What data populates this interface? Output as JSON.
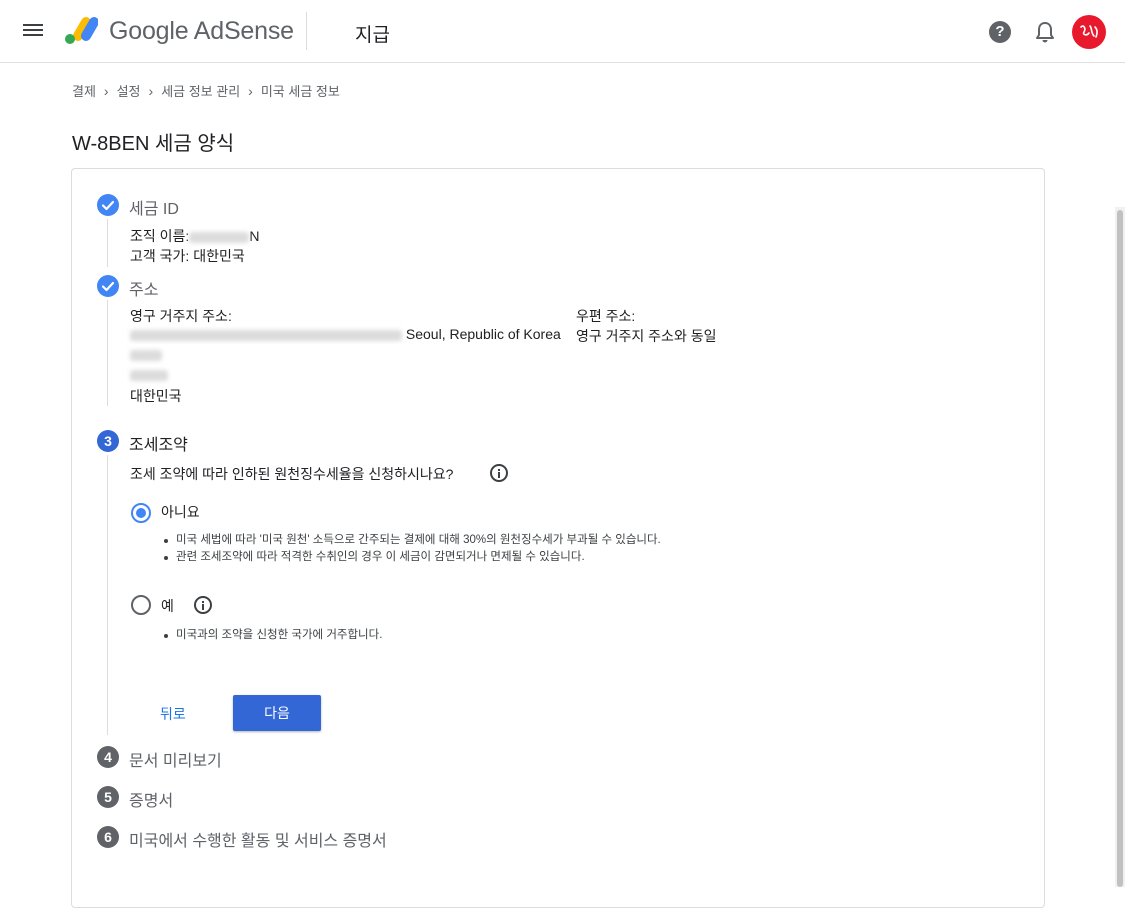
{
  "app": {
    "product_name": "Google AdSense",
    "page_heading": "지급"
  },
  "breadcrumb": [
    "결제",
    "설정",
    "세금 정보 관리",
    "미국 세금 정보"
  ],
  "form": {
    "title": "W-8BEN 세금 양식"
  },
  "steps": [
    {
      "number": "1",
      "title": "세금 ID",
      "state": "done"
    },
    {
      "number": "2",
      "title": "주소",
      "state": "done"
    },
    {
      "number": "3",
      "title": "조세조약",
      "state": "active"
    },
    {
      "number": "4",
      "title": "문서 미리보기",
      "state": "pending"
    },
    {
      "number": "5",
      "title": "증명서",
      "state": "pending"
    },
    {
      "number": "6",
      "title": "미국에서 수행한 활동 및 서비스 증명서",
      "state": "pending"
    }
  ],
  "tax_id": {
    "org_name_label": "조직 이름:",
    "org_name_suffix": "N",
    "country_label": "고객 국가:",
    "country_value": "대한민국"
  },
  "address": {
    "permanent_label": "영구 거주지 주소:",
    "permanent_city": "Seoul, Republic of Korea",
    "permanent_country": "대한민국",
    "mailing_label": "우편 주소:",
    "mailing_value": "영구 거주지 주소와 동일"
  },
  "treaty": {
    "question": "조세 조약에 따라 인하된 원천징수세율을 신청하시나요?",
    "options": [
      {
        "label": "아니요",
        "selected": true,
        "bullets": [
          "미국 세법에 따라 '미국 원천' 소득으로 간주되는 결제에 대해 30%의 원천징수세가 부과될 수 있습니다.",
          "관련 조세조약에 따라 적격한 수취인의 경우 이 세금이 감면되거나 면제될 수 있습니다."
        ]
      },
      {
        "label": "예",
        "selected": false,
        "bullets": [
          "미국과의 조약을 신청한 국가에 거주합니다."
        ]
      }
    ],
    "back_label": "뒤로",
    "next_label": "다음"
  },
  "colors": {
    "primary": "#3367d6",
    "done": "#4285f4",
    "pending": "#5f6368",
    "link": "#1a73e8"
  }
}
